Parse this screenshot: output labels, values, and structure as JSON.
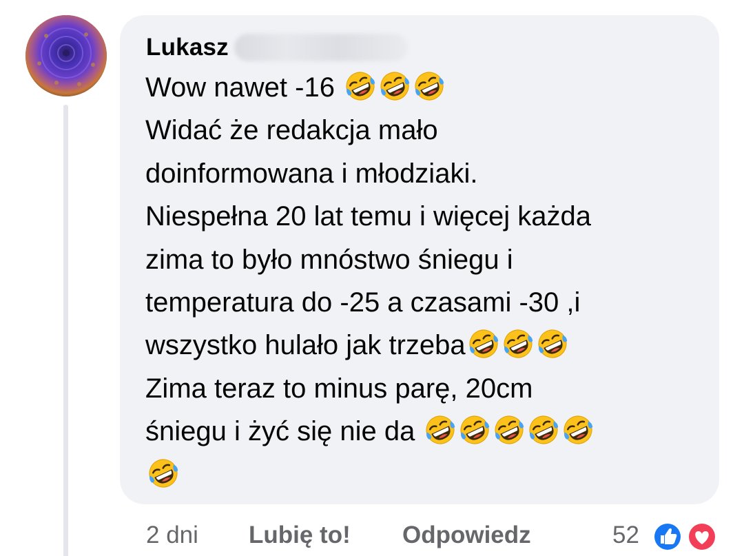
{
  "comment": {
    "author_name": "Lukasz",
    "lines": [
      {
        "text": "Wow nawet -16 ",
        "emoji_count": 3
      },
      {
        "text": "Widać że redakcja mało",
        "emoji_count": 0
      },
      {
        "text": "doinformowana i młodziaki.",
        "emoji_count": 0
      },
      {
        "text": "Niespełna 20 lat temu i więcej każda",
        "emoji_count": 0
      },
      {
        "text": "zima to było mnóstwo śniegu i",
        "emoji_count": 0
      },
      {
        "text": "temperatura do -25 a czasami -30 ,i",
        "emoji_count": 0
      },
      {
        "text": "wszystko hulało jak trzeba",
        "emoji_count": 3
      },
      {
        "text": "Zima teraz to minus parę, 20cm",
        "emoji_count": 0
      },
      {
        "text": "śniegu i żyć się nie da ",
        "emoji_count": 5
      },
      {
        "text": "",
        "emoji_count": 1
      }
    ],
    "emoji_name": "rolling-on-floor-laughing-icon"
  },
  "footer": {
    "time": "2 dni",
    "like_label": "Lubię to!",
    "reply_label": "Odpowiedz",
    "reaction_count": "52",
    "reaction_icons": [
      "like-icon",
      "love-icon"
    ]
  },
  "colors": {
    "bubble_bg": "#f0f2f5",
    "text": "#050505",
    "secondary_text": "#65676b",
    "like_blue": "#1877f2",
    "love_red": "#f33e58",
    "emoji_yellow": "#fcc21b"
  }
}
